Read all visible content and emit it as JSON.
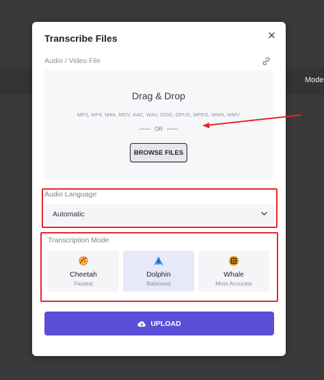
{
  "background": {
    "partial_label": "Mode"
  },
  "modal": {
    "title": "Transcribe Files",
    "file_section_label": "Audio / Video File",
    "dropzone": {
      "title": "Drag & Drop",
      "formats": "MP3, MP4, M4A, MOV, AAC, WAV, OGG, OPUS, MPEG, WMA, WMV",
      "or_text": "OR",
      "browse_label": "BROWSE FILES"
    },
    "language": {
      "label": "Audio Language",
      "selected": "Automatic"
    },
    "mode": {
      "label": "Transcription Mode",
      "options": [
        {
          "name": "Cheetah",
          "sub": "Fastest",
          "icon": "cheetah-icon",
          "selected": false
        },
        {
          "name": "Dolphin",
          "sub": "Balanced",
          "icon": "dolphin-icon",
          "selected": true
        },
        {
          "name": "Whale",
          "sub": "Most Accurate",
          "icon": "whale-icon",
          "selected": false
        }
      ]
    },
    "upload_label": "UPLOAD"
  },
  "colors": {
    "accent": "#5a4fd6",
    "annotation_red": "#e5242a",
    "selected_card": "#e8e9f8"
  }
}
